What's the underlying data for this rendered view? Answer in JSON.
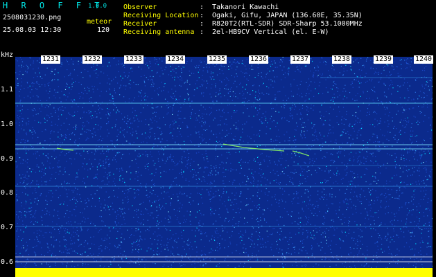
{
  "header": {
    "app_name": "H R O F F T",
    "version": "1.0.0",
    "filename": "2508031230.png",
    "datetime": "25.08.03 12:30",
    "mode_label": "meteor",
    "count": "120",
    "fields": [
      {
        "key": "Observer",
        "value": "Takanori Kawachi"
      },
      {
        "key": "Receiving Location",
        "value": "Ogaki, Gifu, JAPAN (136.60E, 35.35N)"
      },
      {
        "key": "Receiver",
        "value": "R820T2(RTL-SDR) SDR-Sharp 53.1000MHz"
      },
      {
        "key": "Receiving antenna",
        "value": "2el-HB9CV Vertical (el. E-W)"
      }
    ]
  },
  "axes": {
    "freq_unit": "kHz",
    "freq_ticks": [
      "1.1",
      "1.0",
      "0.9",
      "0.8",
      "0.7",
      "0.6"
    ],
    "time_ticks": [
      "1231",
      "1232",
      "1233",
      "1234",
      "1235",
      "1236",
      "1237",
      "1238",
      "1239",
      "1240"
    ]
  },
  "colors": {
    "background": "#0b2a8c",
    "noise_hi": "#00e0ff",
    "baseline": "#ffff00",
    "label_accent": "#ffff00",
    "app_accent": "#00e8e8"
  }
}
